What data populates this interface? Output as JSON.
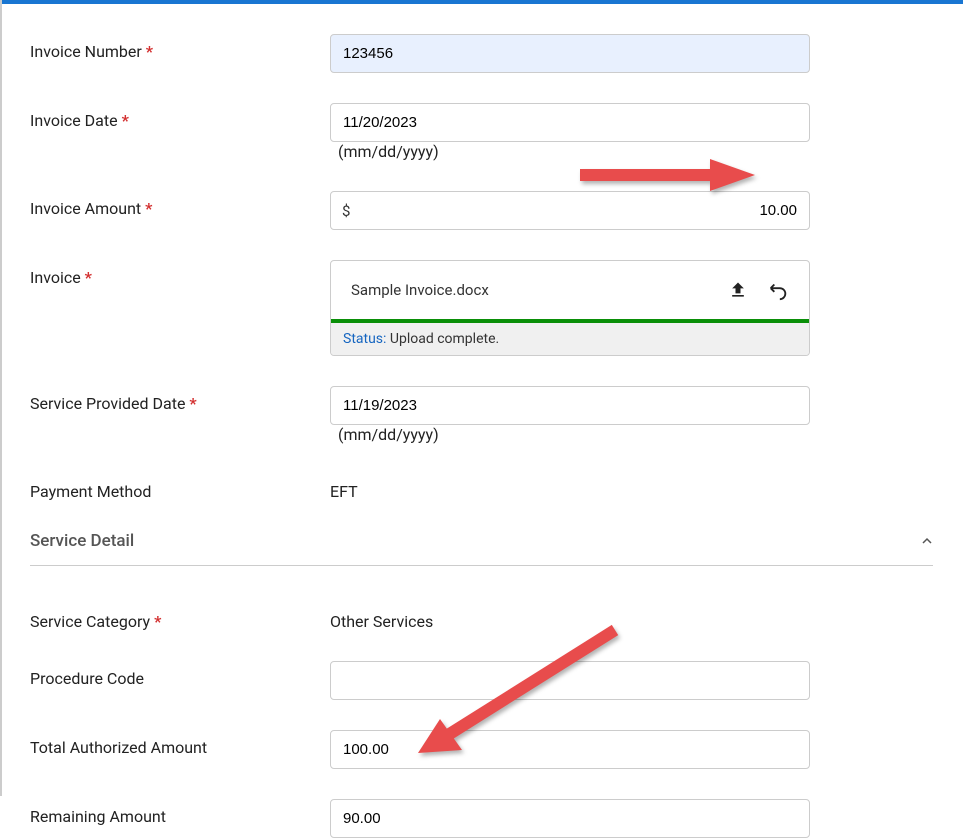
{
  "fields": {
    "invoice_number": {
      "label": "Invoice Number",
      "value": "123456"
    },
    "invoice_date": {
      "label": "Invoice Date",
      "value": "11/20/2023",
      "hint": "(mm/dd/yyyy)"
    },
    "invoice_amount": {
      "label": "Invoice Amount",
      "prefix": "$",
      "value": "10.00"
    },
    "invoice_file": {
      "label": "Invoice",
      "filename": "Sample Invoice.docx",
      "status_label": "Status:",
      "status_value": "Upload complete."
    },
    "service_date": {
      "label": "Service Provided Date",
      "value": "11/19/2023",
      "hint": "(mm/dd/yyyy)"
    },
    "payment_method": {
      "label": "Payment Method",
      "value": "EFT"
    }
  },
  "section": {
    "title": "Service Detail"
  },
  "detail": {
    "service_category": {
      "label": "Service Category",
      "value": "Other Services"
    },
    "procedure_code": {
      "label": "Procedure Code",
      "value": ""
    },
    "total_authorized": {
      "label": "Total Authorized Amount",
      "value": "100.00"
    },
    "remaining": {
      "label": "Remaining Amount",
      "value": "90.00"
    }
  }
}
